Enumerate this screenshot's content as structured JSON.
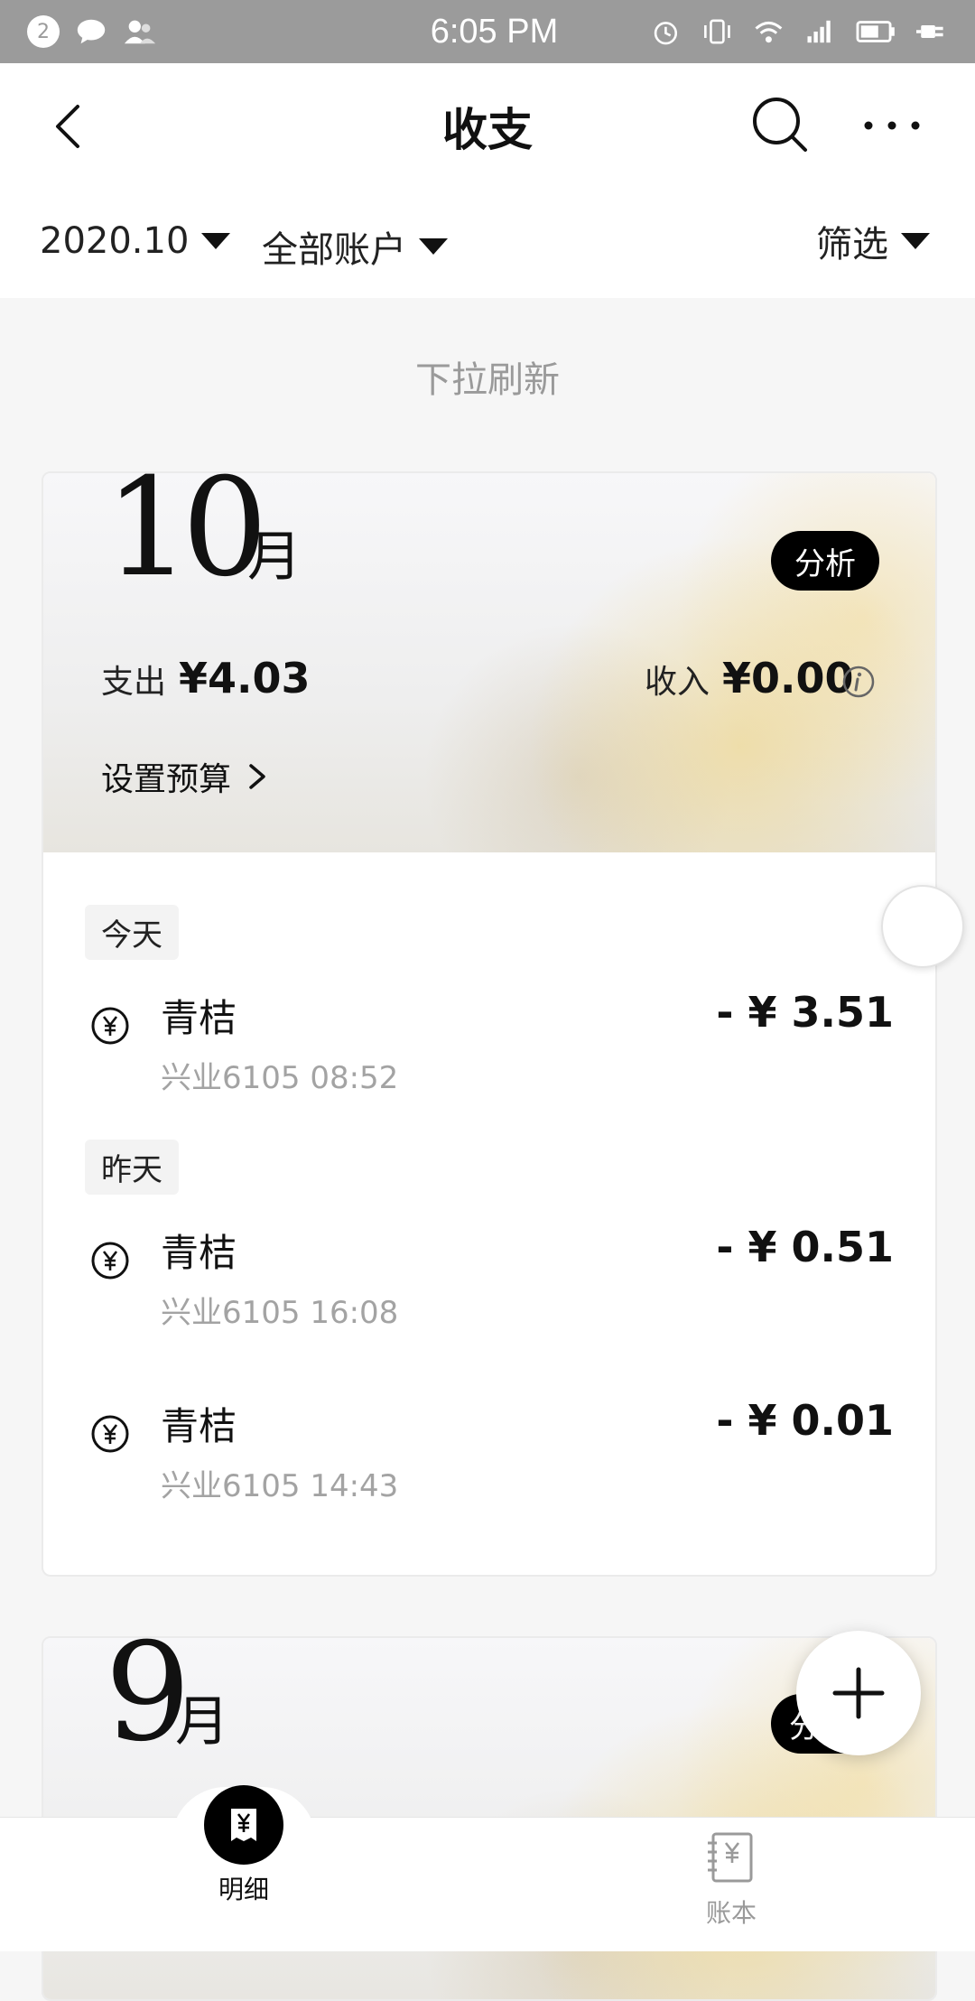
{
  "statusbar": {
    "notification_count": "2",
    "time": "6:05 PM"
  },
  "header": {
    "title": "收支"
  },
  "filters": {
    "month": "2020.10",
    "account": "全部账户",
    "filter": "筛选"
  },
  "pull_hint": "下拉刷新",
  "october": {
    "month_number": "10",
    "month_unit": "月",
    "analysis_label": "分析",
    "spend_label": "支出",
    "spend_value": "¥4.03",
    "income_label": "收入",
    "income_value": "¥0.00",
    "budget_label": "设置预算",
    "groups": [
      {
        "day": "今天",
        "transactions": [
          {
            "name": "青桔",
            "detail": "兴业6105 08:52",
            "amount": "- ¥ 3.51"
          }
        ]
      },
      {
        "day": "昨天",
        "transactions": [
          {
            "name": "青桔",
            "detail": "兴业6105 16:08",
            "amount": "- ¥ 0.51"
          },
          {
            "name": "青桔",
            "detail": "兴业6105 14:43",
            "amount": "- ¥ 0.01"
          }
        ]
      }
    ]
  },
  "september": {
    "month_number": "9",
    "month_unit": "月",
    "analysis_partial": "分"
  },
  "bottom_nav": {
    "detail_label": "明细",
    "books_label": "账本"
  },
  "colors": {
    "accent": "#000000",
    "muted_text": "#a3a3a3",
    "statusbar": "#9b9b9b"
  }
}
